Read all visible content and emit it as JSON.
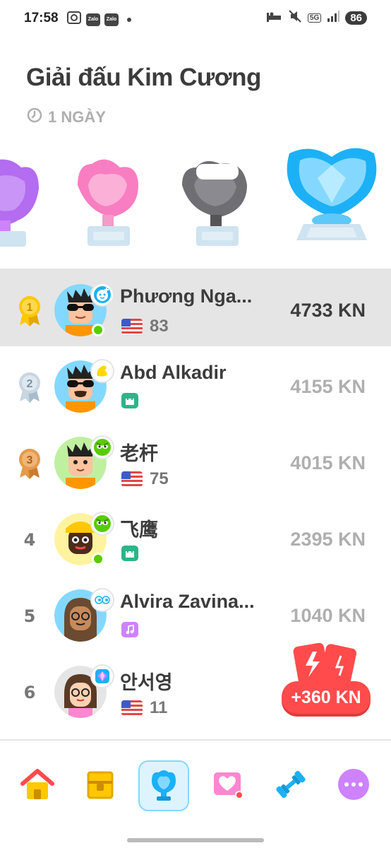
{
  "status": {
    "time": "17:58",
    "zalo1": "Zalo",
    "zalo2": "Zalo",
    "network": "5G",
    "battery": "86"
  },
  "header": {
    "title": "Giải đấu Kim Cương",
    "time_left": "1 NGÀY"
  },
  "leaderboard": [
    {
      "rank": "1",
      "name": "Phương Nga...",
      "streak": "83",
      "xp": "4733 KN",
      "flag": "us",
      "highlight": true
    },
    {
      "rank": "2",
      "name": "Abd Alkadir",
      "streak": "",
      "xp": "4155 KN",
      "chip": "castle"
    },
    {
      "rank": "3",
      "name": "老杆",
      "streak": "75",
      "xp": "4015 KN",
      "flag": "us"
    },
    {
      "rank": "4",
      "name": "飞鹰",
      "streak": "",
      "xp": "2395 KN",
      "chip": "castle"
    },
    {
      "rank": "5",
      "name": "Alvira Zavina...",
      "streak": "",
      "xp": "1040 KN",
      "chip": "music"
    },
    {
      "rank": "6",
      "name": "안서영",
      "streak": "11",
      "xp": "",
      "flag": "us"
    }
  ],
  "boost": {
    "label": "+360 KN"
  },
  "tabs": [
    "home-icon",
    "chest-icon",
    "league-icon",
    "heart-icon",
    "dumbbell-icon",
    "more-icon"
  ],
  "colors": {
    "green": "#58cc02",
    "red": "#ff4b4b",
    "blue": "#1cb0f6",
    "gray": "#afafaf"
  }
}
